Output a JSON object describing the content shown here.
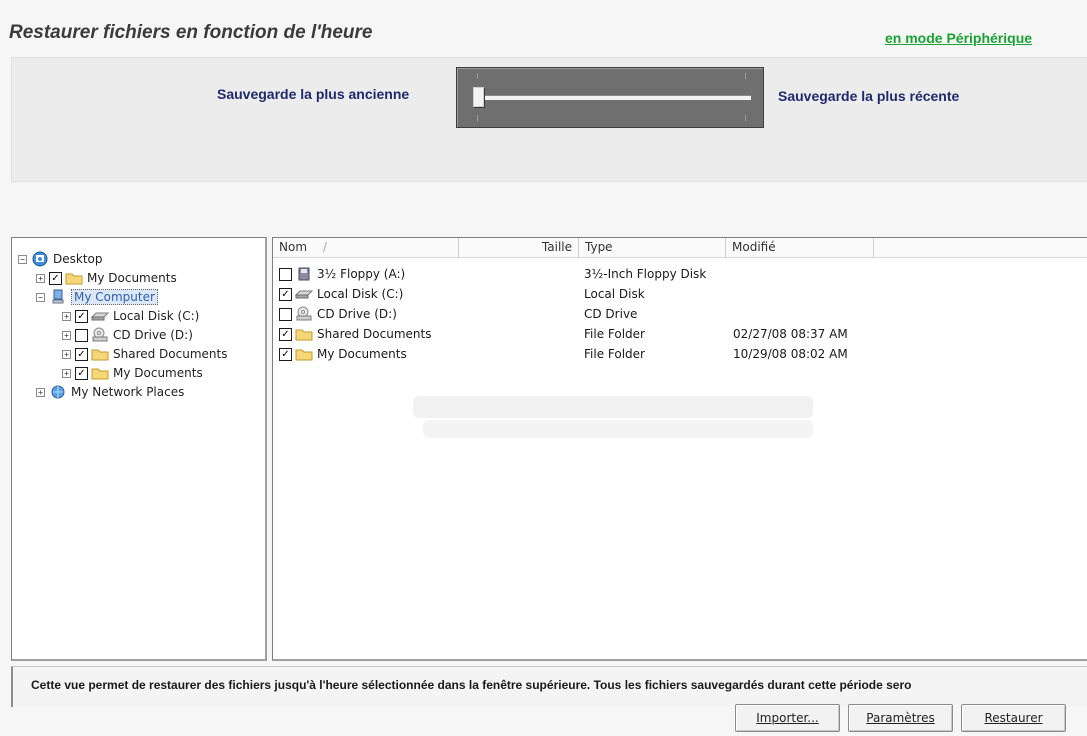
{
  "title": "Restaurer fichiers en fonction de l'heure",
  "mode_link": "en mode Périphérique",
  "timeline": {
    "oldest_label": "Sauvegarde la plus ancienne",
    "newest_label": "Sauvegarde la plus récente",
    "slider_position": 0
  },
  "tree": {
    "items": [
      {
        "label": "Desktop",
        "expander": "−",
        "checkbox": null,
        "icon": "desktop-icon"
      },
      {
        "label": "My Documents",
        "expander": "+",
        "checkbox": "✓",
        "icon": "folder-icon"
      },
      {
        "label": "My Computer",
        "expander": "−",
        "checkbox": null,
        "icon": "computer-icon",
        "selected": true
      },
      {
        "label": "Local Disk (C:)",
        "expander": "+",
        "checkbox": "✓",
        "icon": "hard-disk-icon"
      },
      {
        "label": "CD Drive (D:)",
        "expander": "+",
        "checkbox": "",
        "icon": "cd-drive-icon"
      },
      {
        "label": "Shared Documents",
        "expander": "+",
        "checkbox": "✓",
        "icon": "folder-icon"
      },
      {
        "label": "My Documents",
        "expander": "+",
        "checkbox": "✓",
        "icon": "folder-icon"
      },
      {
        "label": "My Network Places",
        "expander": "+",
        "checkbox": null,
        "icon": "network-icon"
      }
    ]
  },
  "list": {
    "columns": [
      "Nom",
      "/",
      "Taille",
      "Type",
      "Modifié"
    ],
    "rows": [
      {
        "checked": false,
        "icon": "floppy-icon",
        "name": "3½ Floppy (A:)",
        "size": "",
        "type": "3½-Inch Floppy Disk",
        "modified": ""
      },
      {
        "checked": true,
        "icon": "hard-disk-icon",
        "name": "Local Disk (C:)",
        "size": "",
        "type": "Local Disk",
        "modified": ""
      },
      {
        "checked": false,
        "icon": "cd-drive-icon",
        "name": "CD Drive (D:)",
        "size": "",
        "type": "CD Drive",
        "modified": ""
      },
      {
        "checked": true,
        "icon": "folder-icon",
        "name": "Shared Documents",
        "size": "",
        "type": "File Folder",
        "modified": "02/27/08 08:37 AM"
      },
      {
        "checked": true,
        "icon": "folder-icon",
        "name": "My Documents",
        "size": "",
        "type": "File Folder",
        "modified": "10/29/08 08:02 AM"
      }
    ]
  },
  "status_text": "Cette vue permet de restaurer des fichiers jusqu'à l'heure sélectionnée dans la fenêtre supérieure. Tous les fichiers sauvegardés durant cette période sero",
  "buttons": {
    "import": "Importer...",
    "settings": "Paramètres",
    "restore": "Restaurer"
  },
  "colors": {
    "link": "#1aa334",
    "label": "#1f2a6d",
    "slider_bg": "#6f6f6f"
  }
}
